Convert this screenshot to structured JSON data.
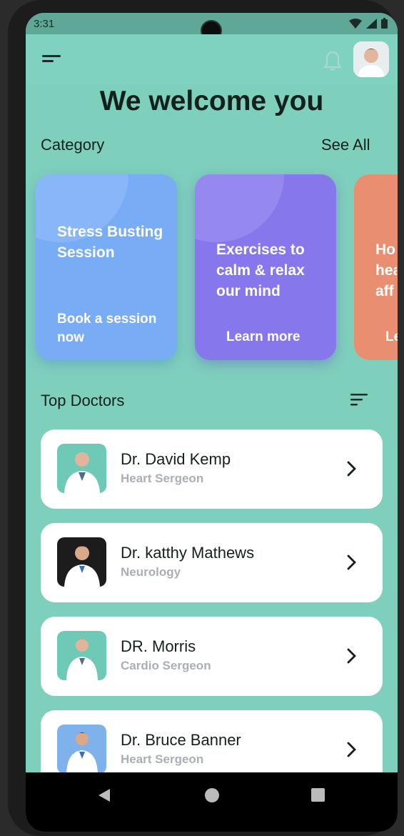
{
  "status_bar": {
    "time": "3:31"
  },
  "header": {
    "title": "We welcome you"
  },
  "category": {
    "heading": "Category",
    "see_all": "See All",
    "cards": [
      {
        "title": "Stress Busting Session",
        "action": "Book a session now",
        "color": "#78acf5"
      },
      {
        "title": "Exercises to calm & relax our mind",
        "action": "Learn more",
        "color": "#8677ec"
      },
      {
        "title": "Ho hea aff",
        "action": "Le",
        "color": "#ea8e71"
      }
    ]
  },
  "doctors": {
    "heading": "Top Doctors",
    "items": [
      {
        "name": "Dr. David Kemp",
        "specialty": "Heart Sergeon"
      },
      {
        "name": "Dr. katthy Mathews",
        "specialty": "Neurology"
      },
      {
        "name": "DR. Morris",
        "specialty": "Cardio Sergeon"
      },
      {
        "name": "Dr. Bruce Banner",
        "specialty": "Heart Sergeon"
      }
    ]
  },
  "icons": {
    "menu": "menu-icon",
    "notification": "bell-icon",
    "filter": "filter-icon",
    "chevron": "chevron-right-icon"
  }
}
